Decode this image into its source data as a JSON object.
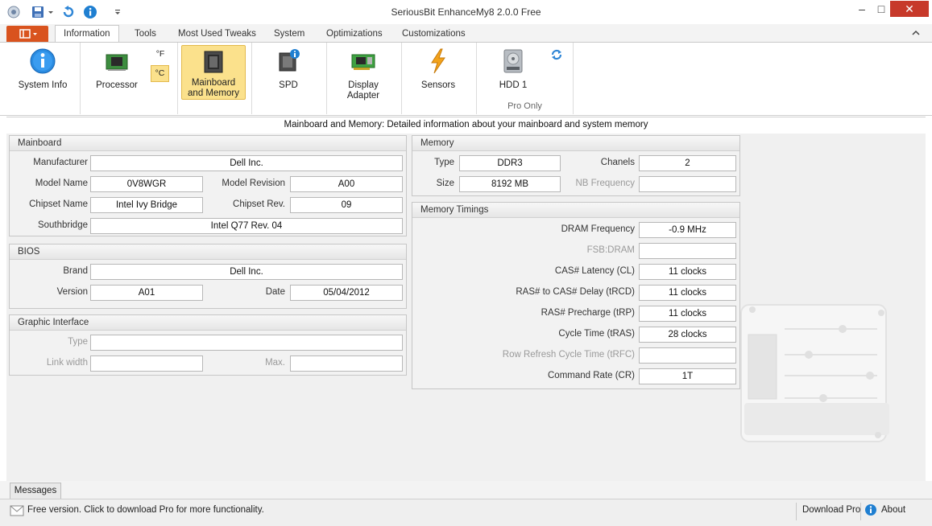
{
  "window": {
    "title": "SeriousBit EnhanceMy8 2.0.0 Free"
  },
  "tabs": [
    "Information",
    "Tools",
    "Most Used Tweaks",
    "System",
    "Optimizations",
    "Customizations"
  ],
  "ribbon": {
    "system_info": "System Info",
    "processor": "Processor",
    "unit_f": "°F",
    "unit_c": "°C",
    "mainboard_line1": "Mainboard",
    "mainboard_line2": "and Memory",
    "spd": "SPD",
    "display_line1": "Display",
    "display_line2": "Adapter",
    "sensors": "Sensors",
    "hdd": "HDD 1",
    "pro_only": "Pro Only"
  },
  "info_strip": "Mainboard and Memory: Detailed information about your mainboard and system memory",
  "mainboard": {
    "header": "Mainboard",
    "manufacturer_label": "Manufacturer",
    "manufacturer": "Dell Inc.",
    "model_name_label": "Model Name",
    "model_name": "0V8WGR",
    "model_revision_label": "Model Revision",
    "model_revision": "A00",
    "chipset_name_label": "Chipset Name",
    "chipset_name": "Intel Ivy Bridge",
    "chipset_rev_label": "Chipset Rev.",
    "chipset_rev": "09",
    "southbridge_label": "Southbridge",
    "southbridge": "Intel Q77 Rev. 04"
  },
  "bios": {
    "header": "BIOS",
    "brand_label": "Brand",
    "brand": "Dell Inc.",
    "version_label": "Version",
    "version": "A01",
    "date_label": "Date",
    "date": "05/04/2012"
  },
  "graphic": {
    "header": "Graphic Interface",
    "type_label": "Type",
    "type": "",
    "link_width_label": "Link width",
    "link_width": "",
    "max_label": "Max.",
    "max": ""
  },
  "memory": {
    "header": "Memory",
    "type_label": "Type",
    "type": "DDR3",
    "chanels_label": "Chanels",
    "chanels": "2",
    "size_label": "Size",
    "size": "8192 MB",
    "nb_frequency_label": "NB Frequency",
    "nb_frequency": ""
  },
  "timings": {
    "header": "Memory Timings",
    "rows": [
      {
        "label": "DRAM Frequency",
        "value": "-0.9 MHz",
        "dim": false
      },
      {
        "label": "FSB:DRAM",
        "value": "",
        "dim": true
      },
      {
        "label": "CAS# Latency (CL)",
        "value": "11 clocks",
        "dim": false
      },
      {
        "label": "RAS# to CAS# Delay (tRCD)",
        "value": "11 clocks",
        "dim": false
      },
      {
        "label": "RAS# Precharge (tRP)",
        "value": "11 clocks",
        "dim": false
      },
      {
        "label": "Cycle Time (tRAS)",
        "value": "28 clocks",
        "dim": false
      },
      {
        "label": "Row Refresh Cycle Time (tRFC)",
        "value": "",
        "dim": true
      },
      {
        "label": "Command Rate (CR)",
        "value": "1T",
        "dim": false
      }
    ]
  },
  "messages_tab": "Messages",
  "status": {
    "message": "Free version. Click to download Pro for more functionality.",
    "download_pro": "Download Pro",
    "about": "About"
  },
  "colors": {
    "accent": "#d9531e",
    "selected": "#fbe18c",
    "info_blue": "#1f7fd1"
  },
  "icons": [
    "app-icon",
    "save-icon",
    "undo-icon",
    "info-icon",
    "dropdown-icon",
    "minimize-icon",
    "maximize-icon",
    "close-icon",
    "collapse-ribbon-icon",
    "processor-icon",
    "mainboard-icon",
    "spd-icon",
    "display-adapter-icon",
    "sensors-icon",
    "hdd-icon",
    "refresh-icon",
    "mail-icon"
  ]
}
